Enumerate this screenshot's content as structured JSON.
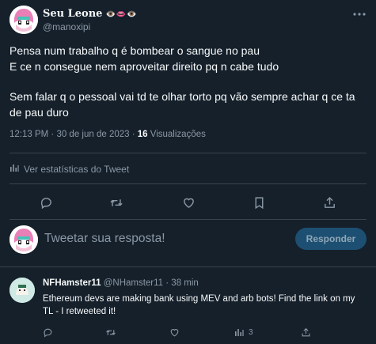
{
  "tweet": {
    "author_name": "Seu Leone",
    "author_emojis": "👁️👄👁️",
    "author_handle": "@manoxipi",
    "body_lines": [
      "Pensa num trabalho q é bombear o sangue no pau",
      "E ce n consegue nem aproveitar direito pq n cabe tudo",
      "Sem falar q o pessoal vai td te olhar torto pq vão sempre achar q ce ta de pau duro"
    ],
    "timestamp": "12:13 PM · 30 de jun de 2023 · ",
    "views_count": "16",
    "views_label": " Visualizações",
    "stats_link": "Ver estatísticas do Tweet",
    "icons": [
      "bar-chart-icon",
      "reply-icon",
      "retweet-icon",
      "like-icon",
      "bookmark-icon",
      "share-icon",
      "more-icon"
    ]
  },
  "reply_box": {
    "placeholder": "Tweetar sua resposta!",
    "button_label": "Responder"
  },
  "comment": {
    "author_name": "NFHamster11",
    "meta": " @NHamster11 · 38 min",
    "text": "Ethereum devs are making bank using MEV and arb bots! Find the link on my TL - I retweeted it!",
    "views": "3"
  },
  "colors": {
    "background": "#15202b",
    "text": "#f7f9f9",
    "secondary": "#8b98a5",
    "accent_button": "#1d4f72"
  }
}
